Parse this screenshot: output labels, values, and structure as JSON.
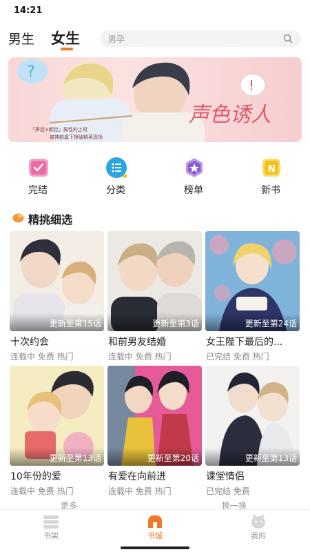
{
  "status_bar": {
    "time": "14:21"
  },
  "top_nav": {
    "tabs": [
      {
        "label": "男生",
        "active": false
      },
      {
        "label": "女生",
        "active": true
      }
    ],
    "search": {
      "placeholder": "男孕"
    },
    "accent_color": "#f0782d"
  },
  "banner": {
    "title": "声色诱人",
    "caption_line1": "「声控+颜控」属性的上司",
    "caption_line2": "被神颜属下撩破精英现场"
  },
  "quick_nav": [
    {
      "label": "完结",
      "icon": "finished-book-icon",
      "color": "#ec6aa8"
    },
    {
      "label": "分类",
      "icon": "category-list-icon",
      "color": "#2aa7e0"
    },
    {
      "label": "榜单",
      "icon": "ranking-badge-icon",
      "color": "#8a5ad6"
    },
    {
      "label": "新书",
      "icon": "new-book-icon",
      "color": "#f2c21b"
    }
  ],
  "section": {
    "title": "精挑细选",
    "icon": "featured-leaf-icon"
  },
  "books": [
    {
      "title": "十次约会",
      "update": "更新至第15话",
      "tags": "连载中 免费 热门"
    },
    {
      "title": "和前男友结婚",
      "update": "更新至第3话",
      "tags": "连载中 免费 热门"
    },
    {
      "title": "女王陛下最后的...",
      "update": "更新至第24话",
      "tags": "已完结 免费 热门"
    },
    {
      "title": "10年份的爱",
      "update": "更新至第13话",
      "tags": "连载中 免费 热门"
    },
    {
      "title": "有爱在向前进",
      "update": "更新至第20话",
      "tags": "连载中 免费 热门"
    },
    {
      "title": "课堂情侣",
      "update": "更新至第13话",
      "tags": "已完结 免费"
    }
  ],
  "more_buttons": {
    "more": "更多",
    "refresh": "换一换"
  },
  "bottom_nav": [
    {
      "label": "书架",
      "icon": "bookshelf-icon",
      "active": false
    },
    {
      "label": "书城",
      "icon": "bookstore-icon",
      "active": true
    },
    {
      "label": "我的",
      "icon": "profile-icon",
      "active": false
    }
  ]
}
